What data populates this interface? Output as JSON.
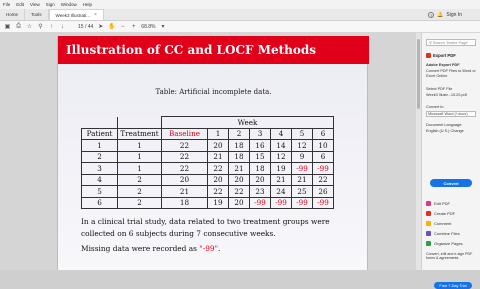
{
  "menubar": [
    "File",
    "Edit",
    "View",
    "Sign",
    "Window",
    "Help"
  ],
  "tabs": [
    {
      "label": "Home"
    },
    {
      "label": "Tools"
    },
    {
      "label": "Week3 Illustrati...",
      "close": "×"
    }
  ],
  "header": {
    "help": "?",
    "sign_in": "Sign In"
  },
  "toolbar": {
    "page_current": "15",
    "page_total": "/ 44",
    "zoom": "68.8%"
  },
  "slide": {
    "title": "Illustration of CC and LOCF Methods",
    "caption": "Table: Artificial incomplete data.",
    "table": {
      "group_header": "Week",
      "headers": [
        "Patient",
        "Treatment",
        "Baseline",
        "1",
        "2",
        "3",
        "4",
        "5",
        "6"
      ],
      "rows": [
        [
          "1",
          "1",
          "22",
          "20",
          "18",
          "16",
          "14",
          "12",
          "10"
        ],
        [
          "2",
          "1",
          "22",
          "21",
          "18",
          "15",
          "12",
          "9",
          "6"
        ],
        [
          "3",
          "1",
          "22",
          "22",
          "21",
          "18",
          "19",
          "-99",
          "-99"
        ],
        [
          "4",
          "2",
          "20",
          "20",
          "20",
          "20",
          "21",
          "21",
          "22"
        ],
        [
          "5",
          "2",
          "21",
          "22",
          "22",
          "23",
          "24",
          "25",
          "26"
        ],
        [
          "6",
          "2",
          "18",
          "19",
          "20",
          "-99",
          "-99",
          "-99",
          "-99"
        ]
      ]
    },
    "paragraph1": "In a clinical trial study, data related to two treatment groups were collected on 6 subjects during 7 consecutive weeks.",
    "paragraph2_prefix": "Missing data were recorded as ",
    "paragraph2_value": "\"-99\"",
    "paragraph2_suffix": "."
  },
  "sidebar": {
    "search_placeholder": "Search 'Delete Page'",
    "panel_title": "Export PDF",
    "panel_subtitle": "Adobe Export PDF",
    "panel_desc": "Convert PDF Files to Word or Excel Online",
    "select_label": "Select PDF File",
    "file_name": "Week3 Illustr...15.20.pdf",
    "convert_to_label": "Convert to",
    "convert_option": "Microsoft Word (*.docx)",
    "doc_lang_label": "Document Language:",
    "doc_lang_value": "English (U.S.) Change",
    "convert_button": "Convert",
    "tools": [
      {
        "label": "Edit PDF",
        "color": "#d63a8c"
      },
      {
        "label": "Create PDF",
        "color": "#e0301e"
      },
      {
        "label": "Comment",
        "color": "#f4b400"
      },
      {
        "label": "Combine Files",
        "color": "#6b4fbb"
      },
      {
        "label": "Organize Pages",
        "color": "#2f9e44"
      }
    ],
    "promo": "Convert, edit and e-sign PDF forms & agreements",
    "trial_button": "Free 7-Day Trial"
  }
}
